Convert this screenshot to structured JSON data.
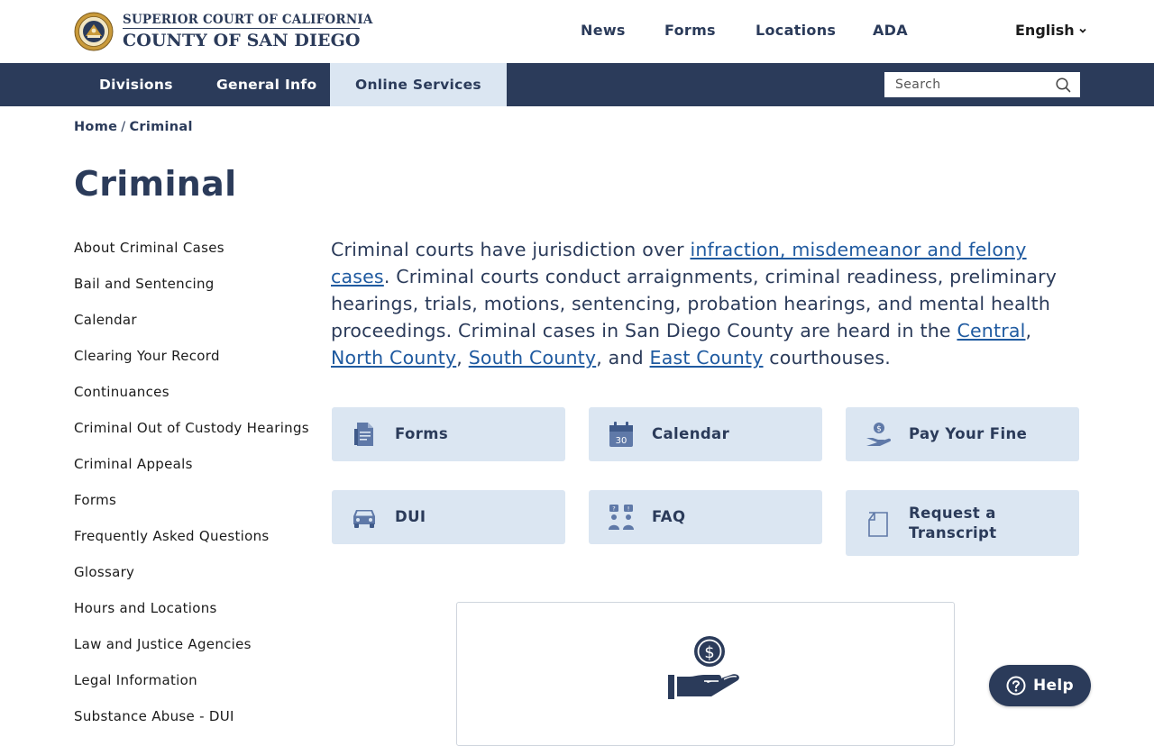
{
  "header": {
    "org_line1": "SUPERIOR COURT OF CALIFORNIA",
    "org_line2": "COUNTY OF SAN DIEGO",
    "top_links": [
      "News",
      "Forms",
      "Locations",
      "ADA"
    ],
    "language": "English"
  },
  "navbar": {
    "items": [
      "Divisions",
      "General Info",
      "Online Services"
    ],
    "active_item": "Online Services",
    "search_placeholder": "Search"
  },
  "breadcrumb": {
    "home": "Home",
    "separator": "/",
    "current": "Criminal"
  },
  "page": {
    "title": "Criminal"
  },
  "sidebar": {
    "items": [
      "About Criminal Cases",
      "Bail and Sentencing",
      "Calendar",
      "Clearing Your Record",
      "Continuances",
      "Criminal Out of Custody Hearings",
      "Criminal Appeals",
      "Forms",
      "Frequently Asked Questions",
      "Glossary",
      "Hours and Locations",
      "Law and Justice Agencies",
      "Legal Information",
      "Substance Abuse - DUI"
    ]
  },
  "intro": {
    "t1": "Criminal courts have jurisdiction over ",
    "link1": "infraction, misdemeanor and felony cases",
    "t2": ". Criminal courts conduct arraignments, criminal readiness, preliminary hearings, trials, motions, sentencing, probation hearings, and mental health proceedings. Criminal cases in San Diego County are heard in the ",
    "link2": "Central",
    "t3": ", ",
    "link3": "North County",
    "t4": ", ",
    "link4": "South County",
    "t5": ", and ",
    "link5": "East County",
    "t6": " courthouses."
  },
  "tiles": [
    {
      "label": "Forms",
      "icon": "forms-document-icon"
    },
    {
      "label": "Calendar",
      "icon": "calendar-icon",
      "icon_text": "30"
    },
    {
      "label": "Pay Your Fine",
      "icon": "hand-coin-icon"
    },
    {
      "label": "DUI",
      "icon": "car-icon"
    },
    {
      "label": "FAQ",
      "icon": "faq-people-icon"
    },
    {
      "label": "Request a Transcript",
      "icon": "transcript-page-icon"
    }
  ],
  "card": {
    "icon": "hand-dollar-coin-icon"
  },
  "help": {
    "label": "Help"
  },
  "colors": {
    "navy": "#2b3b5a",
    "tile_bg": "#dbe6f2",
    "link": "#1f5aa0",
    "icon_blue": "#5f79a8"
  }
}
